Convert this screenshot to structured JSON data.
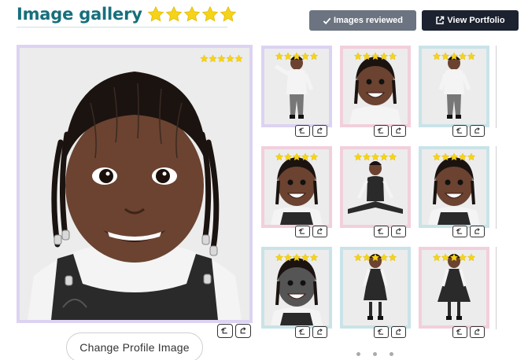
{
  "header": {
    "title": "Image gallery",
    "title_rating": 5,
    "reviewed_button": "Images reviewed",
    "portfolio_button": "View Portfolio"
  },
  "main_image": {
    "rating": 5,
    "change_button": "Change Profile Image"
  },
  "thumbnails": [
    {
      "rating": 5,
      "frame": "purple",
      "subject": "full-body-waving"
    },
    {
      "rating": 5,
      "frame": "pink",
      "subject": "smiling-face"
    },
    {
      "rating": 5,
      "frame": "teal",
      "subject": "full-body-standing"
    },
    {
      "rating": 5,
      "frame": "pink",
      "subject": "laughing-portrait"
    },
    {
      "rating": 5,
      "frame": "pink",
      "subject": "sitting-splits"
    },
    {
      "rating": 5,
      "frame": "teal",
      "subject": "smiling-portrait"
    },
    {
      "rating": 5,
      "frame": "teal",
      "subject": "bw-smiling-face"
    },
    {
      "rating": 5,
      "frame": "teal",
      "subject": "full-body-dress"
    },
    {
      "rating": 5,
      "frame": "pink",
      "subject": "full-body-twirl"
    }
  ],
  "colors": {
    "title": "#176f7c",
    "star": "#f5d31a",
    "reviewed_bg": "#6b7480",
    "portfolio_bg": "#1c2230"
  },
  "icons": [
    "star-icon",
    "check-icon",
    "external-link-icon",
    "rotate-left-icon",
    "rotate-right-icon"
  ],
  "carousel_dots": 3
}
